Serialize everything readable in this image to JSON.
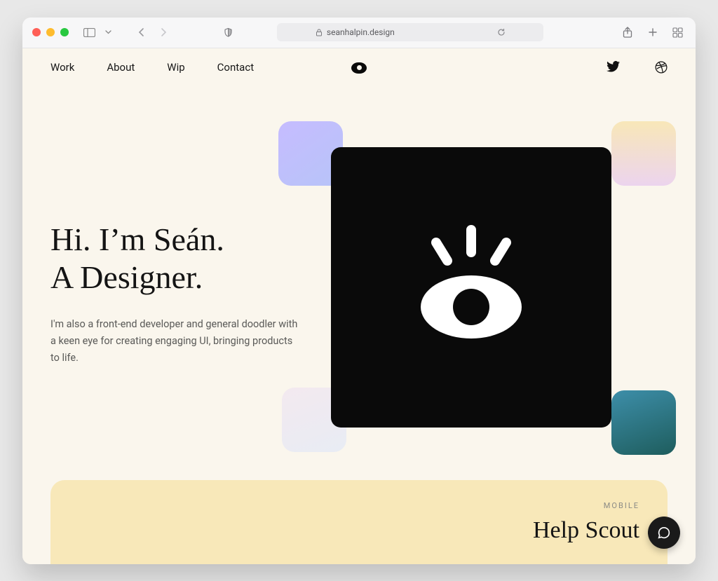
{
  "browser": {
    "url": "seanhalpin.design"
  },
  "nav": {
    "items": [
      "Work",
      "About",
      "Wip",
      "Contact"
    ]
  },
  "hero": {
    "title_line1": "Hi. I’m Seán.",
    "title_line2": "A Designer.",
    "subtitle": "I'm also a front-end developer and general doodler with a keen eye for creating engaging UI, bringing products to life."
  },
  "project": {
    "tag": "MOBILE",
    "title": "Help Scout"
  }
}
